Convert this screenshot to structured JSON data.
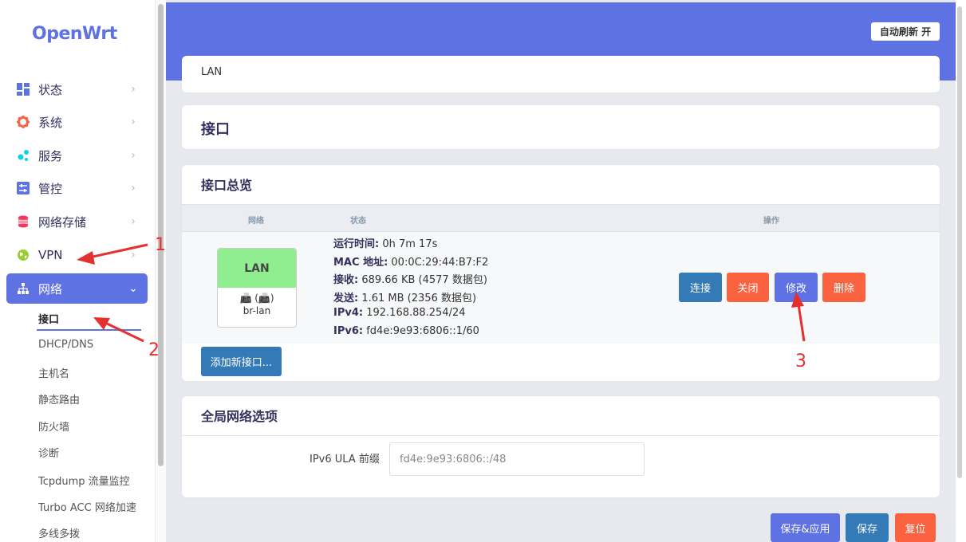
{
  "app": {
    "logo": "OpenWrt"
  },
  "sidebar": {
    "items": [
      {
        "label": "状态",
        "icon": "dashboard-icon",
        "color": "#5e72e4"
      },
      {
        "label": "系统",
        "icon": "gear-icon",
        "color": "#fb6340"
      },
      {
        "label": "服务",
        "icon": "services-icon",
        "color": "#11cdef"
      },
      {
        "label": "管控",
        "icon": "sliders-icon",
        "color": "#5e72e4"
      },
      {
        "label": "网络存储",
        "icon": "database-icon",
        "color": "#f5365c"
      },
      {
        "label": "VPN",
        "icon": "vpn-globe-icon",
        "color": "#9acd32"
      },
      {
        "label": "网络",
        "icon": "network-icon",
        "color": "#ffffff"
      }
    ],
    "subitems": [
      "接口",
      "DHCP/DNS",
      "主机名",
      "静态路由",
      "防火墙",
      "诊断",
      "Tcpdump 流量监控",
      "Turbo ACC 网络加速",
      "多线多拨"
    ]
  },
  "header": {
    "refresh_label": "自动刷新 开"
  },
  "breadcrumb": "LAN",
  "page_title": "接口",
  "overview": {
    "title": "接口总览",
    "columns": [
      "网络",
      "状态",
      "操作"
    ],
    "interface": {
      "name": "LAN",
      "icons": "📠 (📠)",
      "device": "br-lan",
      "status": [
        {
          "key": "运行时间:",
          "value": " 0h 7m 17s"
        },
        {
          "key": "MAC 地址:",
          "value": " 00:0C:29:44:B7:F2"
        },
        {
          "key": "接收:",
          "value": " 689.66 KB (4577 数据包)"
        },
        {
          "key": "发送:",
          "value": " 1.61 MB (2356 数据包)"
        },
        {
          "key": "IPv4:",
          "value": " 192.168.88.254/24"
        },
        {
          "key": "IPv6:",
          "value": " fd4e:9e93:6806::1/60"
        }
      ],
      "actions": {
        "connect": "连接",
        "close": "关闭",
        "edit": "修改",
        "delete": "删除"
      }
    },
    "add_button": "添加新接口..."
  },
  "global": {
    "title": "全局网络选项",
    "ula_label": "IPv6 ULA 前缀",
    "ula_value": "fd4e:9e93:6806::/48"
  },
  "footer": {
    "save_apply": "保存&应用",
    "save": "保存",
    "reset": "复位"
  },
  "annotations": {
    "a1": "1",
    "a2": "2",
    "a3": "3"
  }
}
